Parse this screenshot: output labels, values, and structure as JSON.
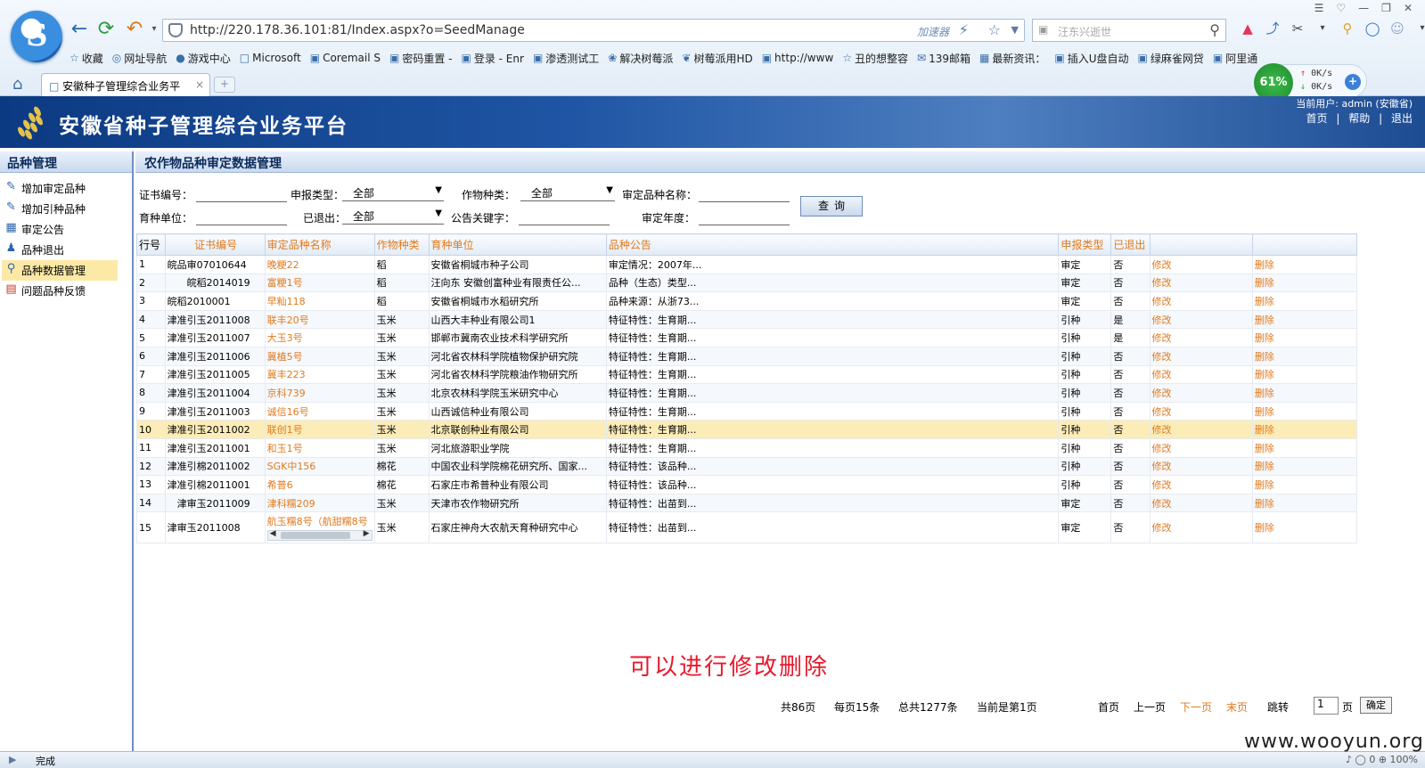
{
  "browser": {
    "url": "http://220.178.36.101:81/Index.aspx?o=SeedManage",
    "accelerator": "加速器",
    "search_placeholder": "汪东兴逝世",
    "tab_title": "安徽种子管理综合业务平",
    "favorites": [
      {
        "label": "收藏",
        "icon": "star"
      },
      {
        "label": "网址导航",
        "icon": "globe"
      },
      {
        "label": "游戏中心",
        "icon": "game"
      },
      {
        "label": "Microsoft",
        "icon": "folder"
      },
      {
        "label": "Coremail S",
        "icon": "page"
      },
      {
        "label": "密码重置 -",
        "icon": "page"
      },
      {
        "label": "登录 - Enr",
        "icon": "page"
      },
      {
        "label": "渗透测试工",
        "icon": "page"
      },
      {
        "label": "解决树莓派",
        "icon": "leaf"
      },
      {
        "label": "树莓派用HD",
        "icon": "paw"
      },
      {
        "label": "http://www",
        "icon": "page"
      },
      {
        "label": "丑的想整容",
        "icon": "star"
      },
      {
        "label": "139邮箱",
        "icon": "mail"
      },
      {
        "label": "最新资讯：",
        "icon": "grid"
      },
      {
        "label": "插入U盘自动",
        "icon": "page"
      },
      {
        "label": "绿麻雀网贷",
        "icon": "page"
      },
      {
        "label": "阿里通",
        "icon": "page"
      }
    ],
    "speed": {
      "percent": "61%",
      "up": "0K/s",
      "down": "0K/s"
    },
    "status_text": "完成",
    "zoom": "100%",
    "status_count": "0"
  },
  "app": {
    "title": "安徽省种子管理综合业务平台",
    "current_user": "当前用户: admin (安徽省)",
    "links": [
      "首页",
      "帮助",
      "退出"
    ],
    "link_sep": "|"
  },
  "sidebar": {
    "title": "品种管理",
    "items": [
      {
        "label": "增加审定品种",
        "active": false
      },
      {
        "label": "增加引种品种",
        "active": false
      },
      {
        "label": "审定公告",
        "active": false
      },
      {
        "label": "品种退出",
        "active": false
      },
      {
        "label": "品种数据管理",
        "active": true
      },
      {
        "label": "问题品种反馈",
        "active": false
      }
    ]
  },
  "main": {
    "title": "农作物品种审定数据管理",
    "filters": {
      "cert_no": "证书编号：",
      "report_type": "申报类型：",
      "report_type_value": "全部",
      "crop_type": "作物种类：",
      "crop_type_value": "全部",
      "variety_name": "审定品种名称：",
      "breeder": "育种单位：",
      "withdrawn": "已退出：",
      "withdrawn_value": "全部",
      "keyword": "公告关键字：",
      "year": "审定年度：",
      "query_button": "查询"
    },
    "table": {
      "headers": [
        "行号",
        "证书编号",
        "审定品种名称",
        "作物种类",
        "育种单位",
        "品种公告",
        "申报类型",
        "已退出",
        "",
        ""
      ],
      "rows": [
        {
          "no": "1",
          "cert": "皖品审07010644",
          "name": "晚粳22",
          "crop": "稻",
          "unit": "安徽省桐城市种子公司",
          "notice": "审定情况：2007年...",
          "type": "审定",
          "out": "否"
        },
        {
          "no": "2",
          "cert": "皖稻2014019",
          "name": "富粳1号",
          "crop": "稻",
          "unit": "汪向东 安徽创富种业有限责任公...",
          "notice": "品种（生态）类型...",
          "type": "审定",
          "out": "否"
        },
        {
          "no": "3",
          "cert": "皖稻2010001",
          "name": "早籼118",
          "crop": "稻",
          "unit": "安徽省桐城市水稻研究所",
          "notice": "品种来源：从浙73...",
          "type": "审定",
          "out": "否"
        },
        {
          "no": "4",
          "cert": "津准引玉2011008",
          "name": "联丰20号",
          "crop": "玉米",
          "unit": "山西大丰种业有限公司1",
          "notice": "特征特性：生育期...",
          "type": "引种",
          "out": "是"
        },
        {
          "no": "5",
          "cert": "津准引玉2011007",
          "name": "大玉3号",
          "crop": "玉米",
          "unit": "邯郸市冀南农业技术科学研究所",
          "notice": "特征特性：生育期...",
          "type": "引种",
          "out": "是"
        },
        {
          "no": "6",
          "cert": "津准引玉2011006",
          "name": "冀植5号",
          "crop": "玉米",
          "unit": "河北省农林科学院植物保护研究院",
          "notice": "特征特性：生育期...",
          "type": "引种",
          "out": "否"
        },
        {
          "no": "7",
          "cert": "津准引玉2011005",
          "name": "冀丰223",
          "crop": "玉米",
          "unit": "河北省农林科学院粮油作物研究所",
          "notice": "特征特性：生育期...",
          "type": "引种",
          "out": "否"
        },
        {
          "no": "8",
          "cert": "津准引玉2011004",
          "name": "京科739",
          "crop": "玉米",
          "unit": "北京农林科学院玉米研究中心",
          "notice": "特征特性：生育期...",
          "type": "引种",
          "out": "否"
        },
        {
          "no": "9",
          "cert": "津准引玉2011003",
          "name": "诚信16号",
          "crop": "玉米",
          "unit": "山西诚信种业有限公司",
          "notice": "特征特性：生育期...",
          "type": "引种",
          "out": "否"
        },
        {
          "no": "10",
          "cert": "津准引玉2011002",
          "name": "联创1号",
          "crop": "玉米",
          "unit": "北京联创种业有限公司",
          "notice": "特征特性：生育期...",
          "type": "引种",
          "out": "否"
        },
        {
          "no": "11",
          "cert": "津准引玉2011001",
          "name": "和玉1号",
          "crop": "玉米",
          "unit": "河北旅游职业学院",
          "notice": "特征特性：生育期...",
          "type": "引种",
          "out": "否"
        },
        {
          "no": "12",
          "cert": "津准引棉2011002",
          "name": "SGK中156",
          "crop": "棉花",
          "unit": "中国农业科学院棉花研究所、国家...",
          "notice": "特征特性：该品种...",
          "type": "引种",
          "out": "否"
        },
        {
          "no": "13",
          "cert": "津准引棉2011001",
          "name": "希普6",
          "crop": "棉花",
          "unit": "石家庄市希普种业有限公司",
          "notice": "特征特性：该品种...",
          "type": "引种",
          "out": "否"
        },
        {
          "no": "14",
          "cert": "津审玉2011009",
          "name": "津科糯209",
          "crop": "玉米",
          "unit": "天津市农作物研究所",
          "notice": "特征特性：出苗到...",
          "type": "审定",
          "out": "否"
        },
        {
          "no": "15",
          "cert": "津审玉2011008",
          "name": "航玉糯8号（航甜糯8号",
          "crop": "玉米",
          "unit": "石家庄神舟大农航天育种研究中心",
          "notice": "特征特性：出苗到...",
          "type": "审定",
          "out": "否"
        }
      ],
      "edit_label": "修改",
      "delete_label": "删除",
      "selected_row": 10
    },
    "pager": {
      "total_pages": "共86页",
      "per_page": "每页15条",
      "total_items": "总共1277条",
      "current": "当前是第1页",
      "first": "首页",
      "prev": "上一页",
      "next": "下一页",
      "last": "末页",
      "jump": "跳转",
      "page_value": "1",
      "page_unit": "页",
      "ok": "确定"
    }
  },
  "annotation": "可以进行修改删除",
  "watermark": "www.wooyun.org"
}
